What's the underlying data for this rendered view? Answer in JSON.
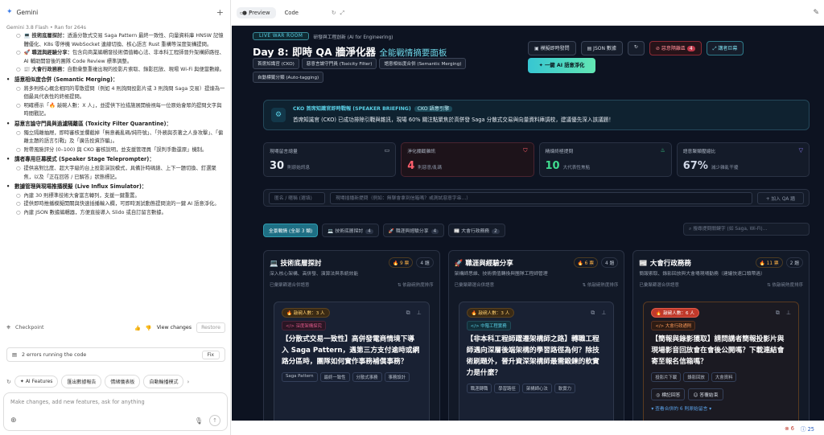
{
  "left_panel": {
    "app_name": "Gemini",
    "model_info": "Gemini 3.8 Flash  •  Ran for 264s",
    "bullets": [
      {
        "level": 2,
        "bold": "💻 技術底層探討：",
        "text": "透過分散式交易 Saga Pattern 最終一致性、向量資料庫 HNSW 記憶體優化、K8s 零停機 WebSocket 連線切換、核心語言 Rust 重構等深度架構提問。"
      },
      {
        "level": 2,
        "bold": "🚀 職涯與經驗分享：",
        "text": "包含向商業編輯發技術價值轉心法、非本科工程師晉升架構師路徑、AI 輔助開發後的團隊 Code Review 標準調整。"
      },
      {
        "level": 2,
        "bold": "📰 大會行政務務：",
        "text": "自動彙整重複出現的投影片索取、錄影回放、現場 Wi-Fi 與便當數線。"
      },
      {
        "level": 1,
        "bold": "語意相似度合併 (Semantic Merging)：",
        "text": ""
      },
      {
        "level": 2,
        "bold": "",
        "text": "將多則核心概念相同的零散提問（例如 4 則詢問投影片或 3 則詢問 Saga 交易）提煉為一個最具代表性的終極提問。"
      },
      {
        "level": 2,
        "bold": "",
        "text": "明確標示「🔥 敲碗人數：X 人」，並提供下拉措施展開檢視每一位原始會眾的提問文字與時間戳記。"
      },
      {
        "level": 1,
        "bold": "惡意言論守門員與過濾隔離區 (Toxicity Filter Quarantine)：",
        "text": ""
      },
      {
        "level": 2,
        "bold": "",
        "text": "獨立隔離抽屜，即時審核並攔截掉「無意義亂碼/純符號」、「外務與衣著之人身攻擊」、「偏離主題的語言引戰」及「廣告投資詐騙」。"
      },
      {
        "level": 2,
        "bold": "",
        "text": "附帶風險評分 (0–100) 與 CKO 審核說明，並支援管理員「誤判手動還原」機制。"
      },
      {
        "level": 1,
        "bold": "講者專用巨幕模式 (Speaker Stage Teleprompter)：",
        "text": ""
      },
      {
        "level": 2,
        "bold": "",
        "text": "提供高對比度、超大字級的台上投影演說模式，具備計時碼錶、上下一題切換、釘選聚焦，以及「正在回答 / 已解答」狀態標記。"
      },
      {
        "level": 1,
        "bold": "數據管理與現場推播模擬 (Live Influx Simulator)：",
        "text": ""
      },
      {
        "level": 2,
        "bold": "",
        "text": "內建 30 則標準技術大會當言轉列，支援一鍵重置。"
      },
      {
        "level": 2,
        "bold": "",
        "text": "提供即時推播模擬開關與快速插播輸入欄，可即時測試動態提問流的一鍵 AI 語意淨化。"
      },
      {
        "level": 2,
        "bold": "",
        "text": "內建 JSON 數據編輯器，方便直接導入 Slido 或自訂留言數據。"
      }
    ],
    "checkpoint": "Checkpoint",
    "view_changes": "View changes",
    "restore": "Restore",
    "error_text": "2 errors running the code",
    "fix": "Fix",
    "chips": [
      "AI Features",
      "匯出數據報告",
      "情緒儀表板",
      "自動輪播模式"
    ],
    "input_placeholder": "Make changes, add new features, ask for anything"
  },
  "toolbar": {
    "preview": "Preview",
    "code": "Code",
    "url": "/"
  },
  "dashboard": {
    "badge": "LIVE WAR ROOM",
    "badge_sub": "研發與工程創新 (AI for Engineering)",
    "title": "Day 8: 即時 QA 牆淨化器",
    "subtitle": "全能戰情摘要面板",
    "tags": [
      "首席知識官 (CKO)",
      "惡意言論守門員 (Toxicity Filter)",
      "語意相似度合併 (Semantic Merging)",
      "自動標籤分類 (Auto-tagging)"
    ],
    "buttons": {
      "simulate": "模擬即時發問",
      "json": "JSON 數據",
      "reset": "↻",
      "quarantine": "惡意隔離區",
      "quarantine_count": "4",
      "stage": "講者巨幕"
    },
    "purify": "一鍵 AI 語意淨化",
    "brief_title": "CKO 首席知識官即時戰報 (SPEAKER BRIEFING)",
    "brief_chip": "CKO 語意引擎",
    "brief_text": "首席知識官 (CKO) 已成功排除引戰與雜訊，現場 60% 關注點聚焦於高併發 Saga 分散式交易與向量資料庫調校，建議優先深入該議題！",
    "stats": [
      {
        "label": "現場留言總量",
        "value": "30",
        "unit": "則原始訊息"
      },
      {
        "label": "淨化攔截雜訊",
        "value": "4",
        "unit": "則惡意/亂碼"
      },
      {
        "label": "精煉終極提問",
        "value": "10",
        "unit": "大代表性焦點"
      },
      {
        "label": "語意聚類壓縮比",
        "value": "67%",
        "unit": "減少雜亂干擾"
      }
    ],
    "add": {
      "name_placeholder": "匿名 / 暱稱 (選填)",
      "q_placeholder": "現場插播新提問（例如：無聊會拿到信箱嗎？或測試惡意字串…）",
      "button": "+ 加入 QA 牆"
    },
    "filters": [
      {
        "label": "全景戰情 (全部 3 類)",
        "count": ""
      },
      {
        "label": "💻 技術底層探討",
        "count": "4"
      },
      {
        "label": "🚀 職涯與經驗分享",
        "count": "4"
      },
      {
        "label": "📰 大會行政務務",
        "count": "2"
      }
    ],
    "search_placeholder": "搜尋提問關鍵字 (如 Saga, Wi-Fi)…",
    "columns": [
      {
        "title": "💻 技術底層探討",
        "votes": "🔥 9 票",
        "qcount": "4 題",
        "desc": "深入核心架構、高併發、演算法與系統效能",
        "foot_left": "已彙聚篩選合併語意",
        "foot_right": "⇅ 依敲碗熱度排序",
        "card": {
          "count": "🔥 敲碗人數：3 人",
          "cat": "</> 深度架構探究",
          "text": "【分散式交易一致性】高併發電商情境下導入 Saga Pattern，遇第三方支付逾時或網路分區時，團隊如何實作事務補償事務？",
          "kws": [
            "Saga Pattern",
            "最終一致性",
            "分散式事務",
            "事務設計"
          ]
        }
      },
      {
        "title": "🚀 職涯與經驗分享",
        "votes": "🔥 6 票",
        "qcount": "4 題",
        "desc": "架構師思維、技術價值轉換與團隊工程師管理",
        "foot_left": "已彙聚篩選合併語意",
        "foot_right": "⇅ 依敲碗熱度排序",
        "card": {
          "count": "🔥 敲碗人數：3 人",
          "cat": "</> 中階工程實務",
          "text": "【非本科工程師躍遷架構師之路】轉職工程師遇向深層後端架構的學習路徑為何？除技術刷題外，晉升資深架構師最需鍛鍊的軟實力是什麼？",
          "kws": [
            "職涯轉職",
            "學習路徑",
            "架構師心法",
            "軟實力"
          ]
        }
      },
      {
        "title": "📰 大會行政務務",
        "votes": "🔥 11 票",
        "qcount": "2 題",
        "desc": "簡報索取、錄影回放與大會場現場勤務（建議快速口頭帶過）",
        "foot_left": "已彙聚篩選合併語意",
        "foot_right": "⇅ 依敲碗熱度排序",
        "card": {
          "count": "🔥 敲碗人數：6 人",
          "cat": "</> 大會行政通則",
          "text": "【簡報與錄影獲取】請問講者簡報投影片與現場影音回放會在會後公開嗎？下載連結會寄至報名信箱嗎？",
          "kws": [
            "投影片下載",
            "錄影回放",
            "大會資料"
          ],
          "actions": [
            "◎ 標記回答",
            "☺ 答覆結束"
          ],
          "more": "▾ 查看合併的 6 則原始留言 ▾"
        }
      }
    ]
  },
  "bottom": {
    "errors": "6",
    "info": "25"
  }
}
